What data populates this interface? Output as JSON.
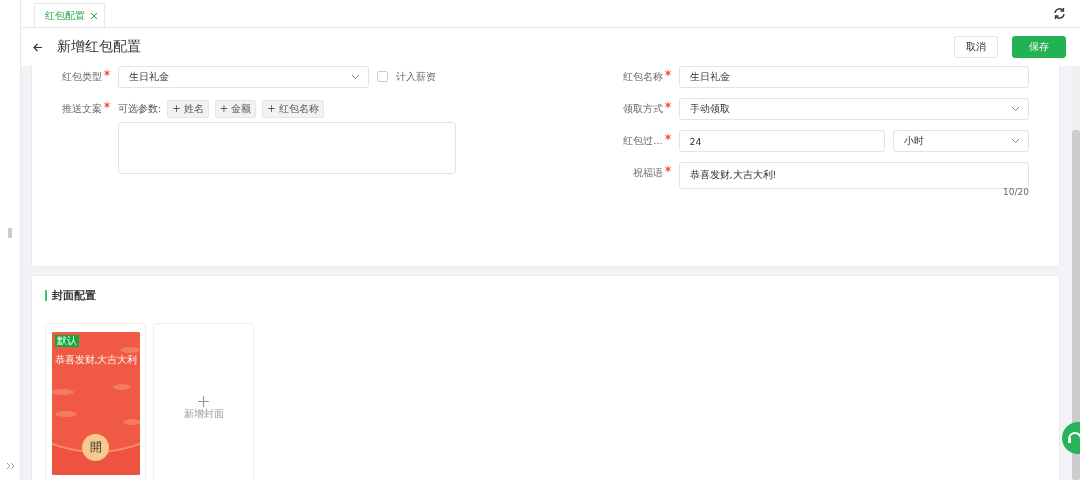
{
  "tabs": [
    {
      "label": "红包配置",
      "selected": true
    }
  ],
  "header": {
    "title": "新增红包配置",
    "buttons": [
      {
        "label": "取消",
        "kind": "default"
      },
      {
        "label": "保存",
        "kind": "primary"
      }
    ]
  },
  "form": {
    "left": [
      {
        "kind": "select",
        "label": "红包类型",
        "required": true,
        "value": "生日礼金",
        "checkbox": {
          "label": "计入薪资",
          "checked": false
        }
      },
      {
        "kind": "template",
        "label": "推送文案",
        "required": true,
        "params_label": "可选参数:",
        "params": [
          "+ 姓名",
          "+ 金额",
          "+ 红包名称"
        ]
      }
    ],
    "right": [
      {
        "kind": "input",
        "label": "红包名称",
        "required": true,
        "value": "生日礼金"
      },
      {
        "kind": "select",
        "label": "领取方式",
        "required": true,
        "value": "手动领取"
      },
      {
        "kind": "duration",
        "label": "红包过...",
        "required": true,
        "value": "24",
        "unit": "小时"
      },
      {
        "kind": "textarea",
        "label": "祝福语",
        "required": true,
        "value": "恭喜发财,大吉大利!",
        "counter": "10/20"
      }
    ]
  },
  "cover_section": {
    "title": "封面配置",
    "covers": [
      {
        "badge": "默认",
        "greeting": "恭喜发财,大吉大利",
        "seal": "開"
      }
    ],
    "add_label": "新增封面"
  }
}
